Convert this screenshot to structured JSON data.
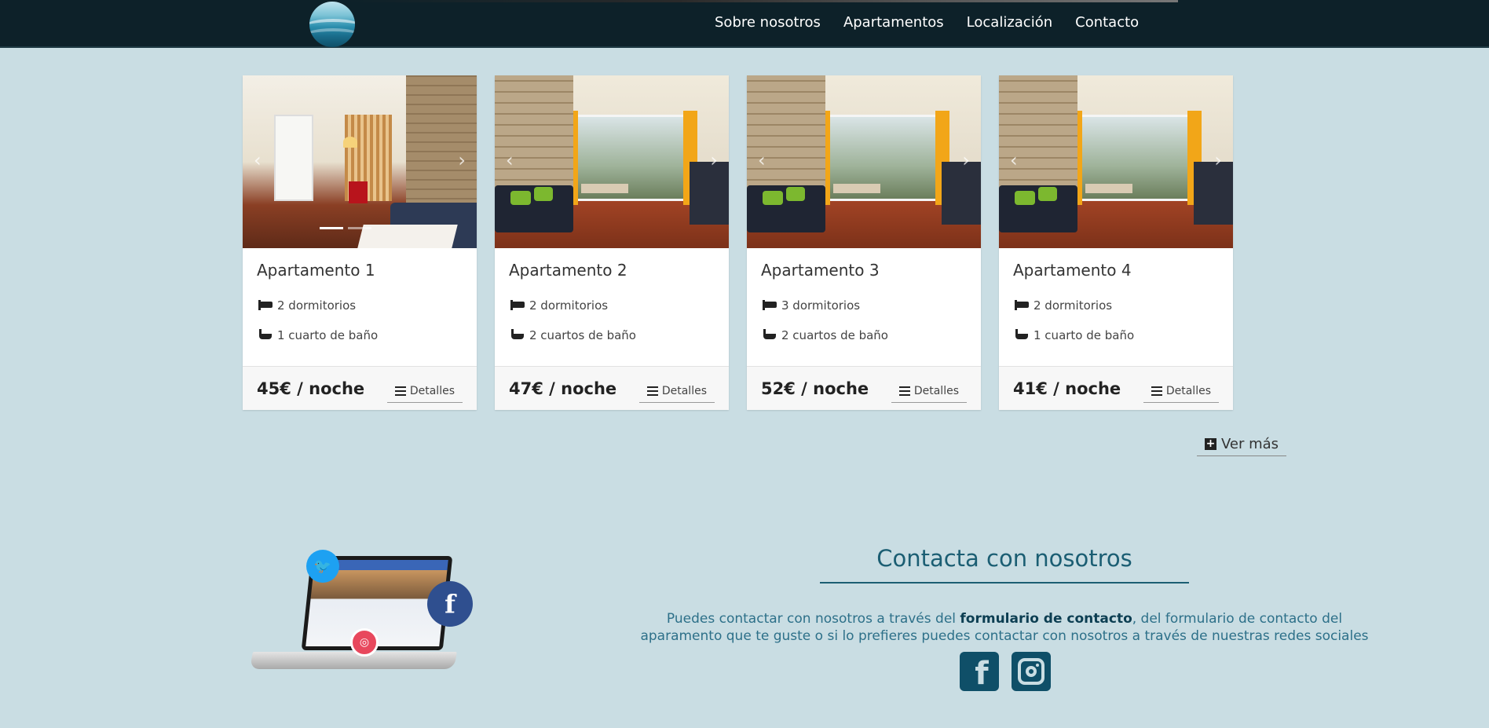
{
  "nav": {
    "items": [
      {
        "label": "Sobre nosotros"
      },
      {
        "label": "Apartamentos"
      },
      {
        "label": "Localización"
      },
      {
        "label": "Contacto"
      }
    ]
  },
  "cards": [
    {
      "title": "Apartamento 1",
      "bedrooms": "2 dormitorios",
      "bathrooms": "1 cuarto de baño",
      "price": "45€ / noche",
      "details_label": "Detalles"
    },
    {
      "title": "Apartamento 2",
      "bedrooms": "2 dormitorios",
      "bathrooms": "2 cuartos de baño",
      "price": "47€ / noche",
      "details_label": "Detalles"
    },
    {
      "title": "Apartamento 3",
      "bedrooms": "3 dormitorios",
      "bathrooms": "2 cuartos de baño",
      "price": "52€ / noche",
      "details_label": "Detalles"
    },
    {
      "title": "Apartamento 4",
      "bedrooms": "2 dormitorios",
      "bathrooms": "1 cuarto de baño",
      "price": "41€ / noche",
      "details_label": "Detalles"
    }
  ],
  "carousel": {
    "prev_glyph": "‹",
    "next_glyph": "›"
  },
  "ver_mas": {
    "label": "Ver más",
    "icon": "plus-square-icon"
  },
  "contact": {
    "title": "Contacta con nosotros",
    "text_before": "Puedes contactar con nosotros a través del ",
    "link_label": "formulario de contacto",
    "text_after": ", del formulario de contacto del aparamento que te guste o si lo prefieres puedes contactar con nosotros a través de nuestras redes sociales"
  },
  "social": {
    "facebook_letter": "f",
    "twitter_glyph": "🐦",
    "instagram_glyph": "◎"
  },
  "colors": {
    "background": "#c9dde3",
    "navbar": "#0d2129",
    "accent": "#1b5e73",
    "social_icon": "#0f4f68"
  }
}
